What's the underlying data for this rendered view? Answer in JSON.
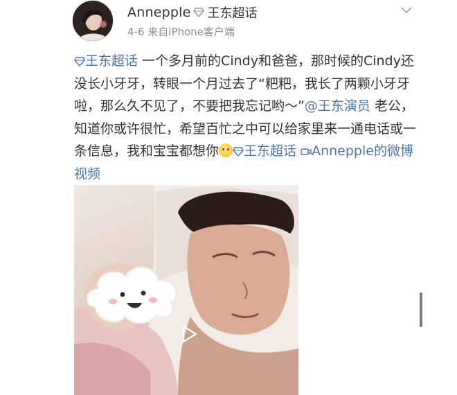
{
  "post": {
    "author": {
      "name": "Annepple",
      "topic_badge": "王东超话",
      "avatar_icon": "avatar-photo"
    },
    "meta": {
      "date": "4-6",
      "source": "来自iPhone客户端"
    },
    "menu_icon": "chevron-down-icon",
    "body": {
      "topic_tag_1": "王东超话",
      "text_1": " 一个多月前的Cindy和爸爸，那时候的Cindy还没长小牙牙，转眼一个月过去了“粑粑，我长了两颗小牙牙啦，那么久不见了，不要把我忘记哟～”",
      "mention": "@王东演员",
      "text_2": " 老公，知道你或许很忙，希望百忙之中可以给家里来一通电话或一条信息，我和宝宝都想你",
      "emoji": "smile-emoji",
      "topic_tag_2": "王东超话",
      "video_link": "Annepple的微博视频"
    },
    "media": {
      "type": "video",
      "play_icon": "play-icon"
    }
  },
  "colors": {
    "link": "#4c75b0",
    "text": "#333333",
    "meta": "#8c8c8c"
  }
}
